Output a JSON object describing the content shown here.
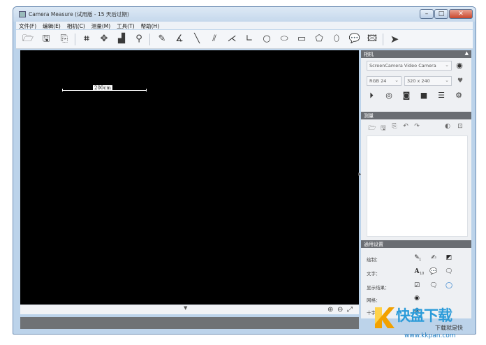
{
  "window": {
    "title": "Camera Measure  (试用版 - 15 天后过期)",
    "minimize": "–",
    "maximize": "□",
    "close": "✕"
  },
  "menu": [
    "文件(F)",
    "编辑(E)",
    "相机(C)",
    "测量(M)",
    "工具(T)",
    "帮助(H)"
  ],
  "toolbar": {
    "icons": [
      "open-icon",
      "save-icon",
      "save-as-icon",
      "crop-icon",
      "move-icon",
      "histogram-icon",
      "zoom-icon",
      "pencil-icon",
      "angle-icon",
      "line-icon",
      "parallel-lines-icon",
      "arrow-angle-icon",
      "polyline-icon",
      "circle-icon",
      "ellipse-icon",
      "rectangle-icon",
      "polygon-icon",
      "freeform-icon",
      "comment-icon",
      "image-icon",
      "pointer-icon"
    ]
  },
  "viewport": {
    "ruler_label": "200cm"
  },
  "panels": {
    "camera": {
      "header": "相机",
      "device": "ScreenCamera Video Camera",
      "format": "RGB 24",
      "resolution": "320 x 240"
    },
    "measure": {
      "header": "测量"
    },
    "settings": {
      "header": "通用设置",
      "rows": [
        "绘制：",
        "文字：",
        "显示结果：",
        "网格：",
        "十字线："
      ],
      "font_size_label": "A",
      "font_size_sub": "10",
      "pencil_sub": "1"
    }
  },
  "watermark": {
    "title": "快盘下载",
    "subtitle": "下载就是快",
    "url": "www.kkpan.com"
  }
}
